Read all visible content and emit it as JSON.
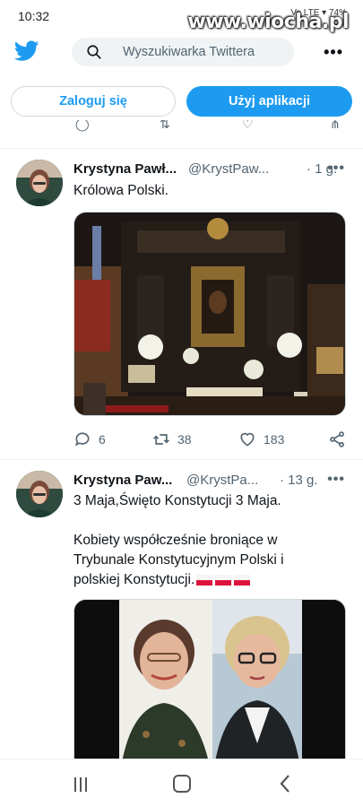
{
  "status_bar": {
    "time": "10:32",
    "icons_text": "Vo LTE ▾ 74%",
    "watermark": "www.wiocha.pl"
  },
  "topbar": {
    "search_placeholder": "Wyszukiwarka Twittera"
  },
  "auth": {
    "login_label": "Zaloguj się",
    "app_label": "Użyj aplikacji"
  },
  "tweets": [
    {
      "author": "Krystyna Pawł...",
      "handle": "@KrystPaw...",
      "time": "· 1 g.",
      "text_lines": [
        "Królowa Polski."
      ],
      "replies": "6",
      "retweets": "38",
      "likes": "183"
    },
    {
      "author": "Krystyna Paw...",
      "handle": "@KrystPa...",
      "time": "· 13 g.",
      "text_lines": [
        "3 Maja,Święto Konstytucji 3 Maja.",
        "",
        "Kobiety współcześnie broniące w",
        "Trybunale Konstytucyjnym Polski i",
        "polskiej Konstytucji."
      ]
    }
  ],
  "colors": {
    "accent": "#1d9bf0",
    "text": "#0f1419",
    "muted": "#536471",
    "border": "#cfd9de"
  },
  "icons": [
    "twitter-logo-icon",
    "search-icon",
    "more-icon",
    "reply-icon",
    "retweet-icon",
    "like-icon",
    "share-icon",
    "polish-flag-icon"
  ]
}
